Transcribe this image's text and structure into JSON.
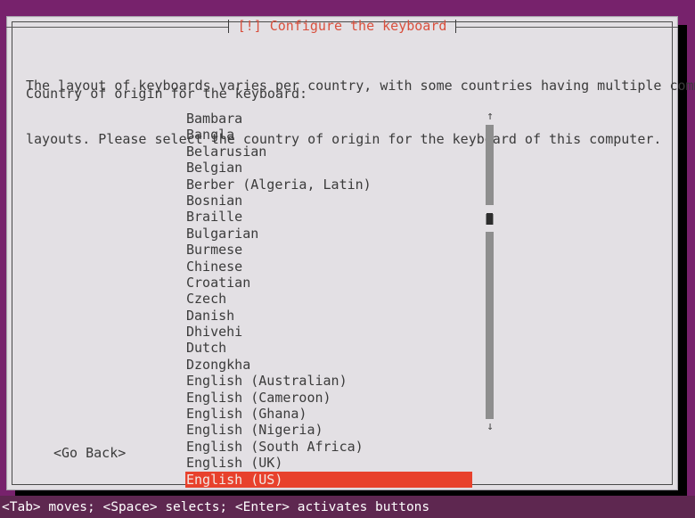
{
  "window": {
    "title": "[!] Configure the keyboard",
    "title_color": "#d94f3d",
    "dialog_bg": "#e3e0e4",
    "backdrop_color": "#77226c"
  },
  "description": {
    "line1": "The layout of keyboards varies per country, with some countries having multiple common",
    "line2": "layouts. Please select the country of origin for the keyboard of this computer."
  },
  "prompt": {
    "label": "Country of origin for the keyboard:"
  },
  "list": {
    "selected_value": "English (US)",
    "selection_color": "#e8412c",
    "items": [
      "Bambara",
      "Bangla",
      "Belarusian",
      "Belgian",
      "Berber (Algeria, Latin)",
      "Bosnian",
      "Braille",
      "Bulgarian",
      "Burmese",
      "Chinese",
      "Croatian",
      "Czech",
      "Danish",
      "Dhivehi",
      "Dutch",
      "Dzongkha",
      "English (Australian)",
      "English (Cameroon)",
      "English (Ghana)",
      "English (Nigeria)",
      "English (South Africa)",
      "English (UK)",
      "English (US)"
    ]
  },
  "scrollbar": {
    "up_arrow": "↑",
    "down_arrow": "↓"
  },
  "buttons": {
    "go_back": "<Go Back>"
  },
  "statusbar": {
    "text": "<Tab> moves; <Space> selects; <Enter> activates buttons"
  }
}
